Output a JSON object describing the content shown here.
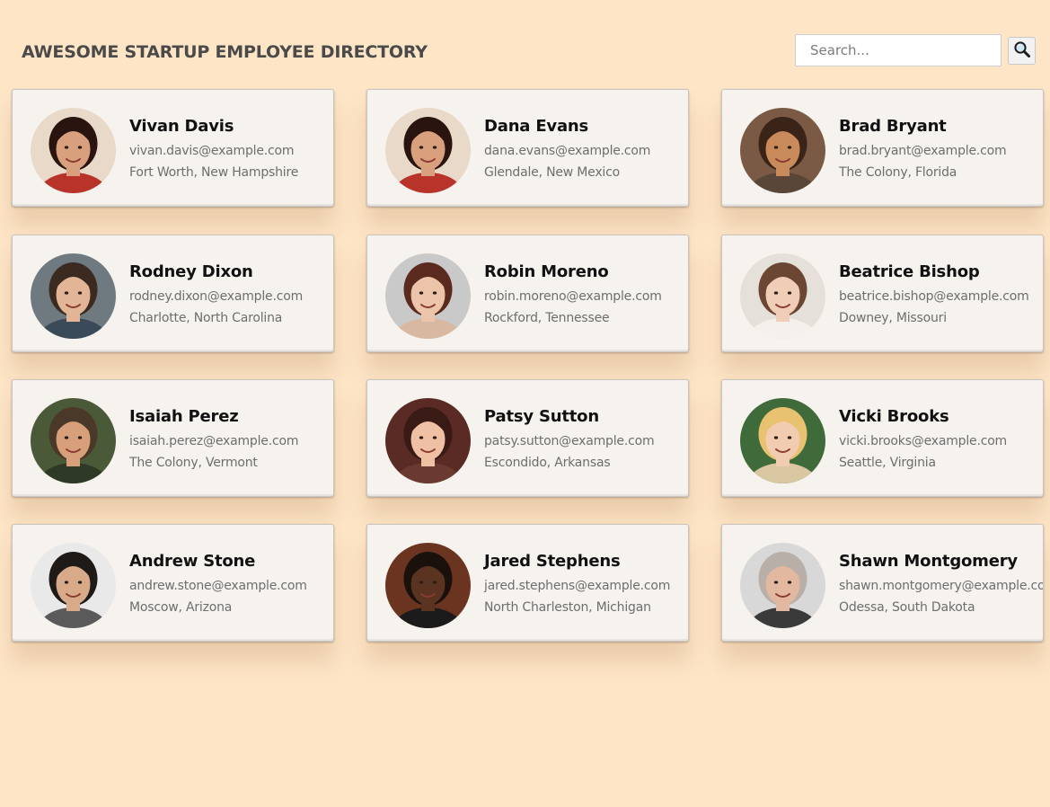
{
  "header": {
    "title": "AWESOME STARTUP EMPLOYEE DIRECTORY",
    "search_placeholder": "Search...",
    "search_value": "",
    "search_icon": "magnifying-glass-icon"
  },
  "colors": {
    "page_background": "#fde5c6",
    "card_background": "#f6f2ee",
    "title": "#4a4a4a",
    "name": "#111111",
    "secondary_text": "#6e6e6e"
  },
  "employees": [
    {
      "name": "Vivan Davis",
      "email": "vivan.davis@example.com",
      "location": "Fort Worth, New Hampshire",
      "avatar": {
        "skin": "#d9a07e",
        "hair": "#2a1410",
        "bg": "#e8d9c8",
        "top": "#b8332a"
      }
    },
    {
      "name": "Dana Evans",
      "email": "dana.evans@example.com",
      "location": "Glendale, New Mexico",
      "avatar": {
        "skin": "#d9a07e",
        "hair": "#2a1410",
        "bg": "#e8d9c8",
        "top": "#b8332a"
      }
    },
    {
      "name": "Brad Bryant",
      "email": "brad.bryant@example.com",
      "location": "The Colony, Florida",
      "avatar": {
        "skin": "#c98a5c",
        "hair": "#3a2418",
        "bg": "#7a5a44",
        "top": "#5a4638"
      }
    },
    {
      "name": "Rodney Dixon",
      "email": "rodney.dixon@example.com",
      "location": "Charlotte, North Carolina",
      "avatar": {
        "skin": "#e3b597",
        "hair": "#3b2a20",
        "bg": "#6f7a80",
        "top": "#3a4a58"
      }
    },
    {
      "name": "Robin Moreno",
      "email": "robin.moreno@example.com",
      "location": "Rockford, Tennessee",
      "avatar": {
        "skin": "#ecc4aa",
        "hair": "#5a2a1e",
        "bg": "#c9c9c9",
        "top": "#d8b8a0"
      }
    },
    {
      "name": "Beatrice Bishop",
      "email": "beatrice.bishop@example.com",
      "location": "Downey, Missouri",
      "avatar": {
        "skin": "#f0cdb6",
        "hair": "#6b4632",
        "bg": "#e6e0da",
        "top": "#f4f0ec"
      }
    },
    {
      "name": "Isaiah Perez",
      "email": "isaiah.perez@example.com",
      "location": "The Colony, Vermont",
      "avatar": {
        "skin": "#d8a07a",
        "hair": "#4a3828",
        "bg": "#4a5a38",
        "top": "#2f3a26"
      }
    },
    {
      "name": "Patsy Sutton",
      "email": "patsy.sutton@example.com",
      "location": "Escondido, Arkansas",
      "avatar": {
        "skin": "#efc0a4",
        "hair": "#3a1a14",
        "bg": "#5a2a24",
        "top": "#6a3a30"
      }
    },
    {
      "name": "Vicki Brooks",
      "email": "vicki.brooks@example.com",
      "location": "Seattle, Virginia",
      "avatar": {
        "skin": "#f2ccb0",
        "hair": "#e8c270",
        "bg": "#3f6a3a",
        "top": "#d9c7a2"
      }
    },
    {
      "name": "Andrew Stone",
      "email": "andrew.stone@example.com",
      "location": "Moscow, Arizona",
      "avatar": {
        "skin": "#d9aa8a",
        "hair": "#1e1a18",
        "bg": "#e9e9e9",
        "top": "#5a5a5a"
      }
    },
    {
      "name": "Jared Stephens",
      "email": "jared.stephens@example.com",
      "location": "North Charleston, Michigan",
      "avatar": {
        "skin": "#5a3420",
        "hair": "#1a100c",
        "bg": "#6a3420",
        "top": "#1b1b1b"
      }
    },
    {
      "name": "Shawn Montgomery",
      "email": "shawn.montgomery@example.com",
      "location": "Odessa, South Dakota",
      "avatar": {
        "skin": "#e3b8a0",
        "hair": "#b8b0a8",
        "bg": "#d8d8d8",
        "top": "#3a3a3a"
      }
    }
  ]
}
